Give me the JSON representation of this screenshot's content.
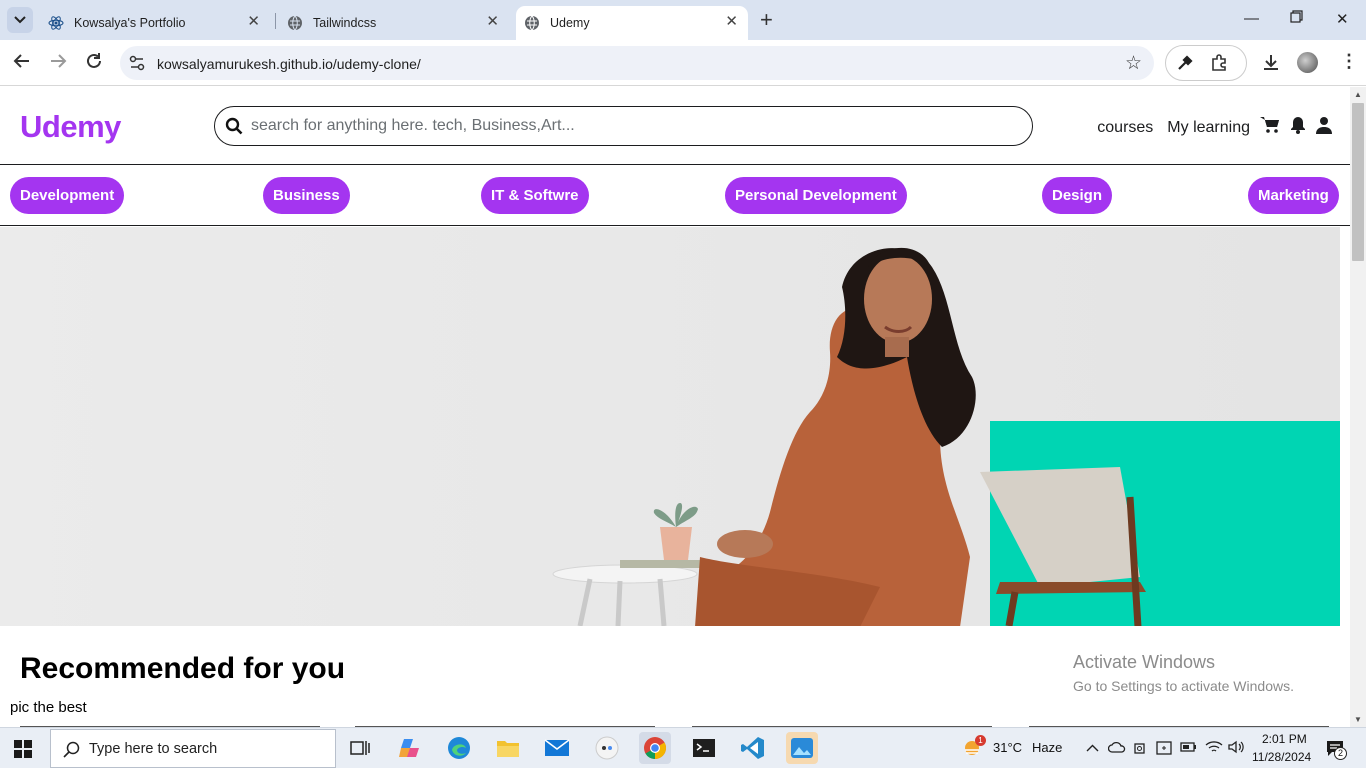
{
  "browser": {
    "tabs": [
      {
        "title": "Kowsalya's Portfolio",
        "active": false
      },
      {
        "title": "Tailwindcss",
        "active": false
      },
      {
        "title": "Udemy",
        "active": true
      }
    ],
    "new_tab": "+",
    "url": "kowsalyamurukesh.github.io/udemy-clone/"
  },
  "header": {
    "logo": "Udemy",
    "search_placeholder": "search for anything here. tech, Business,Art...",
    "links": {
      "courses": "courses",
      "my_learning": "My learning"
    }
  },
  "categories": [
    "Development",
    "Business",
    "IT & Softwre",
    "Personal Development",
    "Design",
    "Marketing"
  ],
  "recommended": {
    "title": "Recommended for you",
    "subtitle": "pic the best"
  },
  "watermark": {
    "line1": "Activate Windows",
    "line2": "Go to Settings to activate Windows."
  },
  "taskbar": {
    "search_placeholder": "Type here to search",
    "weather": {
      "temp": "31°C",
      "condition": "Haze"
    },
    "time": "2:01 PM",
    "date": "11/28/2024",
    "notification_count": "2",
    "weather_badge": "1"
  },
  "colors": {
    "brand": "#a435f0",
    "hero_accent": "#00d5b3"
  }
}
